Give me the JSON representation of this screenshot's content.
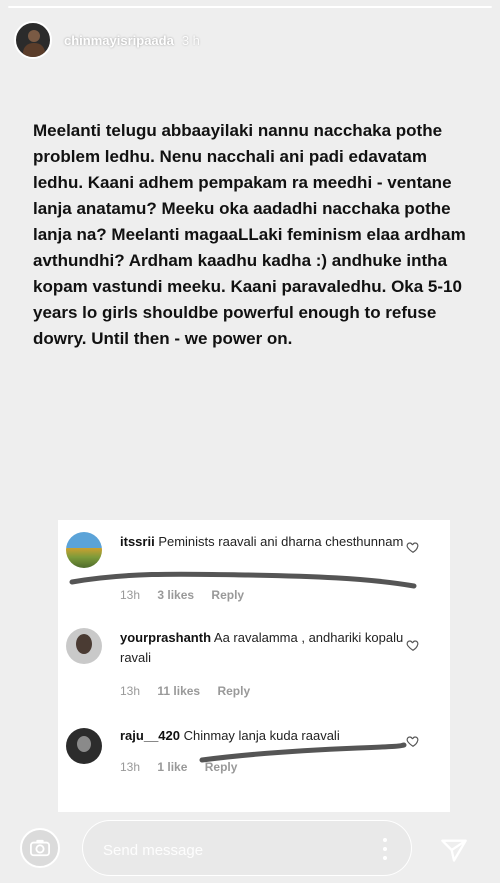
{
  "header": {
    "username": "chinmayisripaada",
    "time": "3 h"
  },
  "caption": {
    "text": "Meelanti telugu abbaayilaki nannu nacchaka pothe problem ledhu. Nenu nacchali ani padi edavatam ledhu. Kaani adhem pempakam ra meedhi - ventane lanja anatamu? Meeku oka aadadhi nacchaka pothe lanja na? Meelanti magaaLLaki feminism elaa ardham avthundhi? Ardham kaadhu kadha :) andhuke intha kopam vastundi meeku. Kaani paravaledhu. Oka 5-10 years lo girls shouldbe powerful enough to refuse dowry. Until then - we power on."
  },
  "comments": [
    {
      "username": "itssrii",
      "text": "Peminists raavali ani dharna chesthunnam",
      "time": "13h",
      "likes": "3 likes",
      "reply": "Reply"
    },
    {
      "username": "yourprashanth",
      "text": "Aa ravalamma , andhariki kopalu ravali",
      "time": "13h",
      "likes": "11 likes",
      "reply": "Reply"
    },
    {
      "username": "raju__420",
      "text": "Chinmay lanja kuda raavali",
      "time": "13h",
      "likes": "1 like",
      "reply": "Reply"
    }
  ],
  "bottom_bar": {
    "message_placeholder": "Send message"
  },
  "icons": {
    "camera": "camera-icon",
    "more": "more-icon",
    "send": "send-icon",
    "heart": "heart-icon"
  }
}
